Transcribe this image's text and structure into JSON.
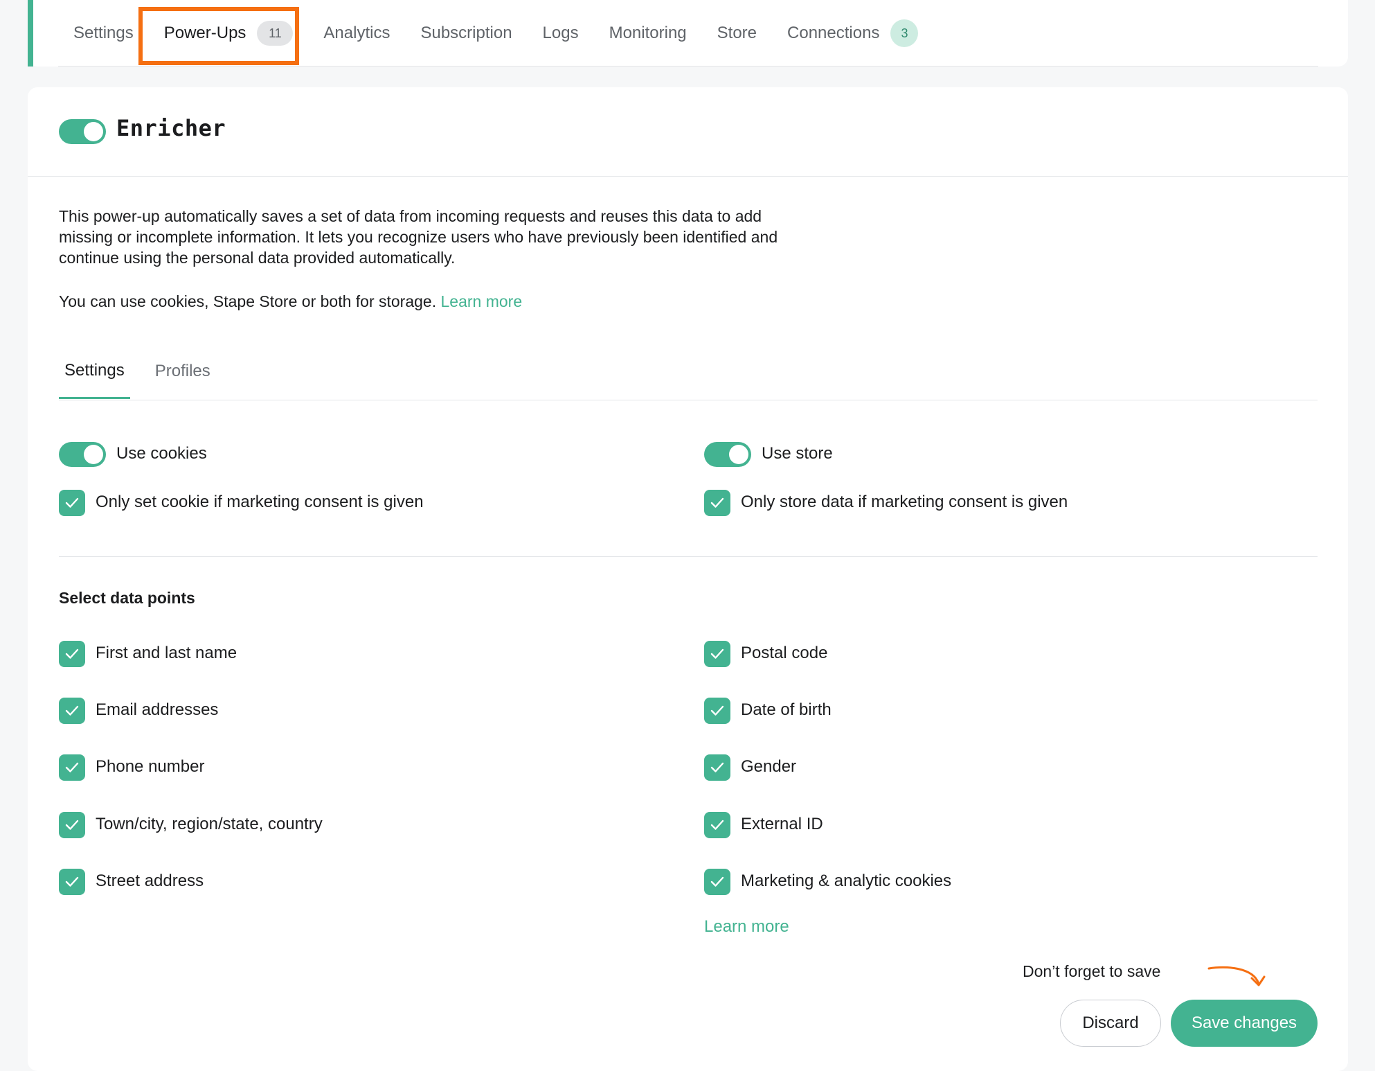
{
  "top_tabs": [
    {
      "label": "Settings"
    },
    {
      "label": "Power-Ups",
      "badge": "11"
    },
    {
      "label": "Analytics"
    },
    {
      "label": "Subscription"
    },
    {
      "label": "Logs"
    },
    {
      "label": "Monitoring"
    },
    {
      "label": "Store"
    },
    {
      "label": "Connections",
      "badge": "3"
    }
  ],
  "active_top_tab": "Power-Ups",
  "header": {
    "title": "Enricher",
    "enabled": true
  },
  "description": {
    "text": "This power-up automatically saves a set of data from incoming requests and reuses this data to add missing or incomplete information. It lets you recognize users who have previously been identified and continue using the personal data provided automatically.",
    "storage_text": "You can use cookies, Stape Store or both for storage.",
    "learn_more": "Learn more"
  },
  "sub_tabs": [
    {
      "label": "Settings"
    },
    {
      "label": "Profiles"
    }
  ],
  "active_sub_tab": "Settings",
  "storage": {
    "use_cookies": {
      "label": "Use cookies",
      "enabled": true
    },
    "cookie_consent": {
      "label": "Only set cookie if marketing consent is given",
      "checked": true
    },
    "use_store": {
      "label": "Use store",
      "enabled": true
    },
    "store_consent": {
      "label": "Only store data if marketing consent is given",
      "checked": true
    }
  },
  "data_points": {
    "title": "Select data points",
    "left": [
      {
        "label": "First and last name",
        "checked": true
      },
      {
        "label": "Email addresses",
        "checked": true
      },
      {
        "label": "Phone number",
        "checked": true
      },
      {
        "label": "Town/city, region/state, country",
        "checked": true
      },
      {
        "label": "Street address",
        "checked": true
      }
    ],
    "right": [
      {
        "label": "Postal code",
        "checked": true
      },
      {
        "label": "Date of birth",
        "checked": true
      },
      {
        "label": "Gender",
        "checked": true
      },
      {
        "label": "External ID",
        "checked": true
      },
      {
        "label": "Marketing & analytic cookies",
        "checked": true
      }
    ],
    "learn_more": "Learn more"
  },
  "footer": {
    "reminder": "Don’t forget to save",
    "discard_label": "Discard",
    "save_label": "Save changes"
  },
  "colors": {
    "accent": "#43b391",
    "highlight": "#f56f12"
  }
}
